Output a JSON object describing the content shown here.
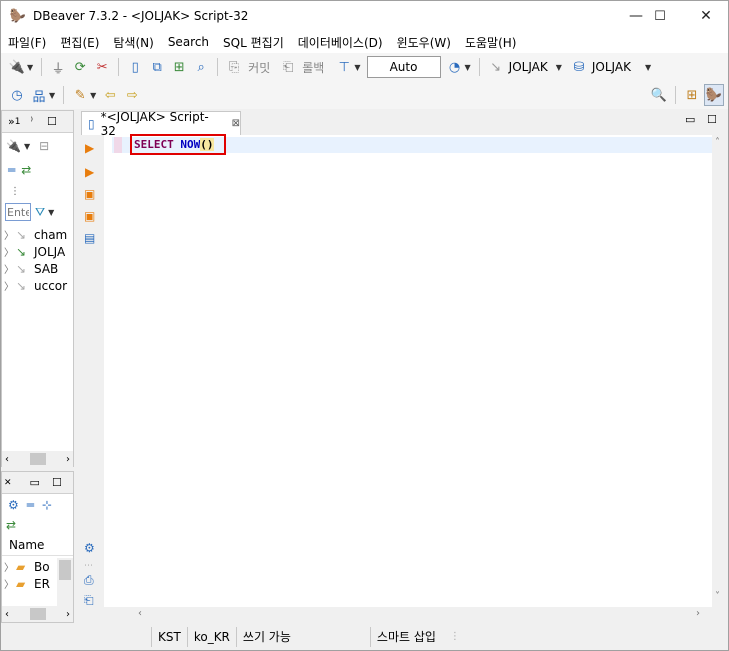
{
  "window": {
    "title": "DBeaver 7.3.2 - <JOLJAK> Script-32",
    "minimize_glyph": "—",
    "maximize_glyph": "☐",
    "close_glyph": "✕"
  },
  "menu": [
    "파일(F)",
    "편집(E)",
    "탐색(N)",
    "Search",
    "SQL 편집기",
    "데이터베이스(D)",
    "윈도우(W)",
    "도움말(H)"
  ],
  "toolbar": {
    "commit_label": "커밋",
    "rollback_label": "롤백",
    "transaction_mode": "Auto",
    "active_connection": "JOLJAK",
    "active_database": "JOLJAK"
  },
  "navigator": {
    "tab_number": "1",
    "filter_placeholder": "Ente",
    "connections": [
      {
        "label": "cham",
        "icon": "connection-icon"
      },
      {
        "label": "JOLJA",
        "icon": "connection-connected-icon"
      },
      {
        "label": "SAB",
        "icon": "connection-icon"
      },
      {
        "label": "uccor",
        "icon": "connection-icon"
      }
    ]
  },
  "projects": {
    "column_header": "Name",
    "items": [
      {
        "label": "Bo",
        "icon": "bookmarks-folder-icon"
      },
      {
        "label": "ER",
        "icon": "er-diagrams-folder-icon"
      }
    ]
  },
  "editor": {
    "tab_label": "*<JOLJAK> Script-32",
    "code": {
      "keyword": "SELECT",
      "function": "NOW",
      "parens": "()"
    }
  },
  "status": {
    "timezone": "KST",
    "locale": "ko_KR",
    "write_mode": "쓰기 가능",
    "insert_mode": "스마트 삽입"
  },
  "colors": {
    "highlight_border": "#e00000",
    "keyword": "#7f0055",
    "function": "#0000c0",
    "current_line": "#e8f2fe"
  }
}
